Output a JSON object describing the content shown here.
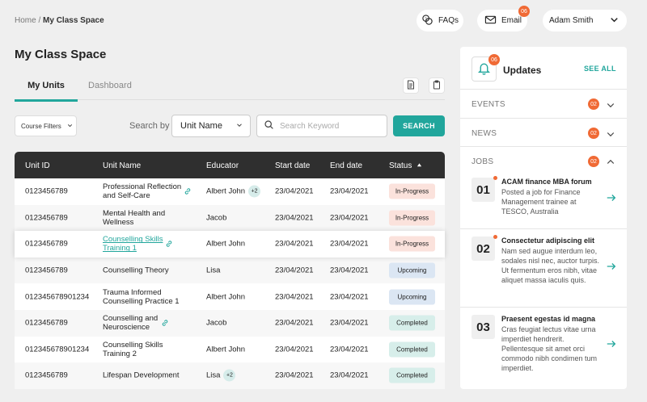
{
  "breadcrumb": {
    "home": "Home",
    "sep": " / ",
    "current": "My Class Space"
  },
  "header": {
    "faqs_label": "FAQs",
    "email_label": "Email",
    "email_badge": "06",
    "user_name": "Adam Smith"
  },
  "page_title": "My Class Space",
  "tabs": [
    {
      "label": "My Units",
      "active": true
    },
    {
      "label": "Dashboard",
      "active": false
    }
  ],
  "filters": {
    "course_filters_label": "Course Filters",
    "search_by_label": "Search by",
    "search_by_value": "Unit Name",
    "search_placeholder": "Search Keyword",
    "search_button": "SEARCH"
  },
  "table": {
    "columns": [
      "Unit ID",
      "Unit Name",
      "Educator",
      "Start date",
      "End date",
      "Status"
    ],
    "rows": [
      {
        "id": "0123456789",
        "name": "Professional Reflection and Self-Care",
        "educator": "Albert John",
        "extra": "+2",
        "start": "23/04/2021",
        "end": "23/04/2021",
        "status": "In-Progress"
      },
      {
        "id": "0123456789",
        "name": "Mental Health and Wellness",
        "educator": "Jacob",
        "extra": "",
        "start": "23/04/2021",
        "end": "23/04/2021",
        "status": "In-Progress"
      },
      {
        "id": "0123456789",
        "name": "Counselling Skills Training 1",
        "educator": "Albert John",
        "extra": "",
        "start": "23/04/2021",
        "end": "23/04/2021",
        "status": "In-Progress"
      },
      {
        "id": "0123456789",
        "name": "Counselling Theory",
        "educator": "Lisa",
        "extra": "",
        "start": "23/04/2021",
        "end": "23/04/2021",
        "status": "Upcoming"
      },
      {
        "id": "012345678901234",
        "name": "Trauma Informed Counselling Practice 1",
        "educator": "Albert John",
        "extra": "",
        "start": "23/04/2021",
        "end": "23/04/2021",
        "status": "Upcoming"
      },
      {
        "id": "0123456789",
        "name": "Counselling and Neuroscience",
        "educator": "Jacob",
        "extra": "",
        "start": "23/04/2021",
        "end": "23/04/2021",
        "status": "Completed"
      },
      {
        "id": "012345678901234",
        "name": "Counselling Skills Training 2",
        "educator": "Albert John",
        "extra": "",
        "start": "23/04/2021",
        "end": "23/04/2021",
        "status": "Completed"
      },
      {
        "id": "0123456789",
        "name": "Lifespan Development",
        "educator": "Lisa",
        "extra": "+2",
        "start": "23/04/2021",
        "end": "23/04/2021",
        "status": "Completed"
      }
    ]
  },
  "updates": {
    "title": "Updates",
    "badge": "06",
    "see_all": "SEE ALL",
    "sections": [
      {
        "label": "EVENTS",
        "badge": "02"
      },
      {
        "label": "NEWS",
        "badge": "02"
      },
      {
        "label": "JOBS",
        "badge": "02"
      }
    ],
    "jobs": [
      {
        "num": "01",
        "title": "ACAM finance MBA forum",
        "desc": "Posted a job for Finance Management trainee at TESCO, Australia"
      },
      {
        "num": "02",
        "title": "Consectetur adipiscing elit",
        "desc": "Nam sed augue interdum leo, sodales nisl nec, auctor turpis. Ut fermentum eros nibh, vitae aliquet massa iaculis quis."
      },
      {
        "num": "03",
        "title": "Praesent egestas id magna",
        "desc": "Cras feugiat lectus vitae urna imperdiet hendrerit. Pellentesque sit amet orci commodo nibh condimen tum imperdiet."
      }
    ]
  },
  "colors": {
    "accent": "#21a69c",
    "badge": "#f06a35",
    "header_dark": "#2f2f2f"
  }
}
